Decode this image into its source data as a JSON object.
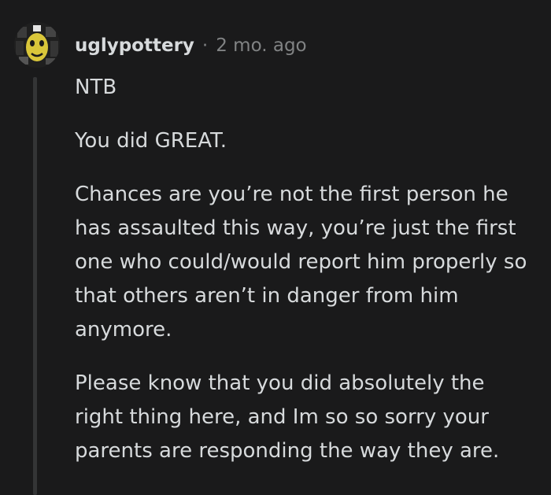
{
  "comment": {
    "author": "uglypottery",
    "separator": "·",
    "timestamp": "2 mo. ago",
    "paragraphs": [
      "NTB",
      "You did GREAT.",
      "Chances are you’re not the first person he has assaulted this way, you’re just the first one who could/would report him properly so that others aren’t in danger from him anymore.",
      "Please know that you did absolutely the right thing here, and Im so so sorry your parents are responding the way they are."
    ]
  },
  "colors": {
    "background": "#1a1a1b",
    "text": "#d7dadc",
    "meta": "#818384",
    "thread_line": "#343536",
    "avatar_accent": "#d9c63a"
  }
}
